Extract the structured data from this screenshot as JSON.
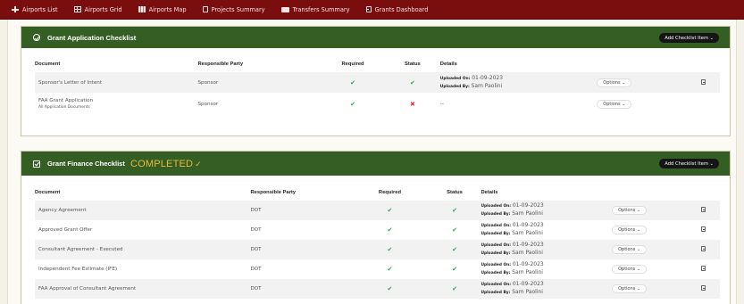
{
  "nav": {
    "items": [
      {
        "label": "Airports List",
        "icon": "plane-icon"
      },
      {
        "label": "Airports Grid",
        "icon": "grid-icon"
      },
      {
        "label": "Airports Map",
        "icon": "map-icon"
      },
      {
        "label": "Projects Summary",
        "icon": "document-icon"
      },
      {
        "label": "Transfers Summary",
        "icon": "card-icon"
      },
      {
        "label": "Grants Dashboard",
        "icon": "dashboard-icon"
      }
    ]
  },
  "grant_application": {
    "title": "Grant Application Checklist",
    "add_label": "Add Checklist Item ⌄",
    "columns": {
      "document": "Document",
      "party": "Responsible Party",
      "required": "Required",
      "status": "Status",
      "details": "Details"
    },
    "rows": [
      {
        "document": "Sponsor's Letter of Intent",
        "sub": "",
        "party": "Sponsor",
        "required": "✔",
        "status": "✔",
        "uploaded_on_label": "Uploaded On:",
        "uploaded_on": "01-09-2023",
        "uploaded_by_label": "Uploaded By:",
        "uploaded_by": "Sam Paolini",
        "options": "Options ⌄"
      },
      {
        "document": "FAA Grant Application",
        "sub": "All Application Documents",
        "party": "Sponsor",
        "required": "✔",
        "status": "✖",
        "details": "--",
        "options": "Options ⌄"
      }
    ]
  },
  "grant_finance": {
    "title": "Grant Finance Checklist",
    "completed_label": "COMPLETED",
    "completed_tick": "✓",
    "add_label": "Add Checklist Item ⌄",
    "columns": {
      "document": "Document",
      "party": "Responsible Party",
      "required": "Required",
      "status": "Status",
      "details": "Details"
    },
    "rows": [
      {
        "document": "Agency Agreement",
        "party": "DOT",
        "required": "✔",
        "status": "✔",
        "uploaded_on_label": "Uploaded On:",
        "uploaded_on": "01-09-2023",
        "uploaded_by_label": "Uploaded By:",
        "uploaded_by": "Sam Paolini",
        "options": "Options ⌄"
      },
      {
        "document": "Approved Grant Offer",
        "party": "DOT",
        "required": "✔",
        "status": "✔",
        "uploaded_on_label": "Uploaded On:",
        "uploaded_on": "01-09-2023",
        "uploaded_by_label": "Uploaded By:",
        "uploaded_by": "Sam Paolini",
        "options": "Options ⌄"
      },
      {
        "document": "Consultant Agreement - Executed",
        "party": "DOT",
        "required": "✔",
        "status": "✔",
        "uploaded_on_label": "Uploaded On:",
        "uploaded_on": "01-09-2023",
        "uploaded_by_label": "Uploaded By:",
        "uploaded_by": "Sam Paolini",
        "options": "Options ⌄"
      },
      {
        "document": "Independent Fee Estimate (IFE)",
        "party": "DOT",
        "required": "✔",
        "status": "✔",
        "uploaded_on_label": "Uploaded On:",
        "uploaded_on": "01-09-2023",
        "uploaded_by_label": "Uploaded By:",
        "uploaded_by": "Sam Paolini",
        "options": "Options ⌄"
      },
      {
        "document": "FAA Approval of Consultant Agreement",
        "party": "DOT",
        "required": "✔",
        "status": "✔",
        "uploaded_on_label": "Uploaded On:",
        "uploaded_on": "01-09-2023",
        "uploaded_by_label": "Uploaded By:",
        "uploaded_by": "Sam Paolini",
        "options": "Options ⌄"
      }
    ]
  }
}
